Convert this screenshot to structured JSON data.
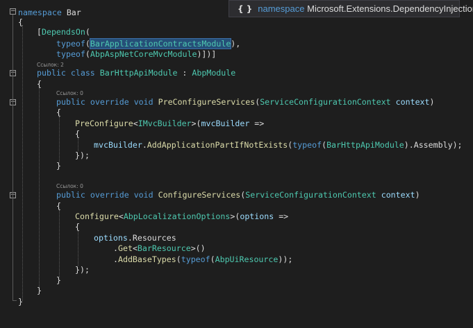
{
  "tooltip": {
    "icon": "namespace-icon",
    "icon_glyph": "{ }",
    "keyword": "namespace",
    "name": "Microsoft.Extensions.DependencyInjection"
  },
  "code": {
    "l1": [
      "namespace",
      "Bar"
    ],
    "l2": "{",
    "l3": [
      "[",
      "DependsOn",
      "("
    ],
    "l4": [
      "typeof",
      "(",
      "BarApplicationContractsModule",
      "),"
    ],
    "l5": [
      "typeof",
      "(",
      "AbpAspNetCoreMvcModule",
      ")])]"
    ],
    "lens_class": "Ссылок: 2",
    "l6": [
      "public",
      "class",
      "BarHttpApiModule",
      " : ",
      "AbpModule"
    ],
    "l7": "{",
    "lens_pre": "Ссылок: 0",
    "l8": [
      "public",
      "override",
      "void",
      "PreConfigureServices",
      "(",
      "ServiceConfigurationContext",
      "context",
      ")"
    ],
    "l9": "{",
    "l10": [
      "PreConfigure",
      "<",
      "IMvcBuilder",
      ">(",
      "mvcBuilder",
      " =>"
    ],
    "l11": "{",
    "l12": [
      "mvcBuilder",
      ".",
      "AddApplicationPartIfNotExists",
      "(",
      "typeof",
      "(",
      "BarHttpApiModule",
      ").Assembly);"
    ],
    "l13": "});",
    "l14": "}",
    "lens_cfg": "Ссылок: 0",
    "l15": [
      "public",
      "override",
      "void",
      "ConfigureServices",
      "(",
      "ServiceConfigurationContext",
      "context",
      ")"
    ],
    "l16": "{",
    "l17": [
      "Configure",
      "<",
      "AbpLocalizationOptions",
      ">(",
      "options",
      " =>"
    ],
    "l18": "{",
    "l19": [
      "options",
      ".Resources"
    ],
    "l20": [
      ".",
      "Get",
      "<",
      "BarResource",
      ">()"
    ],
    "l21": [
      ".",
      "AddBaseTypes",
      "(",
      "typeof",
      "(",
      "AbpUiResource",
      "));"
    ],
    "l22": "});",
    "l23": "}",
    "l24": "}",
    "l25": "}"
  }
}
